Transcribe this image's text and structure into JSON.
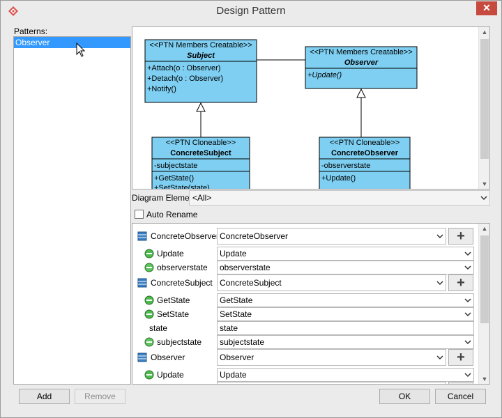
{
  "window": {
    "title": "Design Pattern",
    "close_symbol": "✕"
  },
  "patterns": {
    "label": "Patterns:",
    "items": [
      "Observer"
    ]
  },
  "diagram": {
    "subject": {
      "stereotype": "<<PTN Members Creatable>>",
      "name": "Subject",
      "ops": [
        "+Attach(o : Observer)",
        "+Detach(o : Observer)",
        "+Notify()"
      ]
    },
    "observer": {
      "stereotype": "<<PTN Members Creatable>>",
      "name": "Observer",
      "ops": [
        "+Update()"
      ]
    },
    "concrete_subject": {
      "stereotype": "<<PTN Cloneable>>",
      "name": "ConcreteSubject",
      "attrs": [
        "-subjectstate"
      ],
      "ops": [
        "+GetState()",
        "+SetState(state)"
      ]
    },
    "concrete_observer": {
      "stereotype": "<<PTN Cloneable>>",
      "name": "ConcreteObserver",
      "attrs": [
        "-observerstate"
      ],
      "ops": [
        "+Update()"
      ]
    }
  },
  "diagram_element": {
    "label": "Diagram Element",
    "value": "<All>"
  },
  "auto_rename": {
    "label": "Auto Rename",
    "checked": false
  },
  "properties": [
    {
      "kind": "class",
      "name": "ConcreteObserver",
      "value": "ConcreteObserver"
    },
    {
      "kind": "operation",
      "name": "Update",
      "value": "Update"
    },
    {
      "kind": "attribute",
      "name": "observerstate",
      "value": "observerstate"
    },
    {
      "kind": "class",
      "name": "ConcreteSubject",
      "value": "ConcreteSubject"
    },
    {
      "kind": "operation",
      "name": "GetState",
      "value": "GetState"
    },
    {
      "kind": "operation",
      "name": "SetState",
      "value": "SetState"
    },
    {
      "kind": "parameter",
      "name": "state",
      "value": "state"
    },
    {
      "kind": "attribute",
      "name": "subjectstate",
      "value": "subjectstate"
    },
    {
      "kind": "class",
      "name": "Observer",
      "value": "Observer"
    },
    {
      "kind": "operation",
      "name": "Update",
      "value": "Update"
    }
  ],
  "buttons": {
    "add": "Add",
    "remove": "Remove",
    "ok": "OK",
    "cancel": "Cancel"
  },
  "colors": {
    "uml_fill": "#7ecff2",
    "selection": "#3399ff",
    "close": "#c74a3e"
  },
  "icons": {
    "class": "class-icon",
    "operation": "operation-icon",
    "attribute": "attribute-icon",
    "plus": "plus-icon",
    "dropdown": "chevron-down-icon"
  }
}
